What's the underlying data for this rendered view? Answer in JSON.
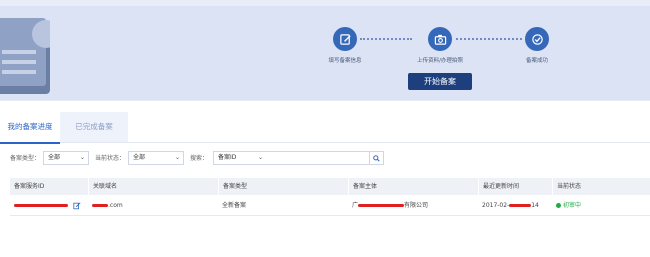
{
  "hero": {
    "steps": [
      {
        "label": "填写备案信息",
        "icon": "edit-icon"
      },
      {
        "label": "上传资料/办理拍照",
        "icon": "camera-icon"
      },
      {
        "label": "备案成功",
        "icon": "check-circle-icon"
      }
    ],
    "start_button": "开始备案"
  },
  "tabs": [
    {
      "label": "我的备案进度",
      "active": true
    },
    {
      "label": "已完成备案",
      "active": false
    }
  ],
  "filters": {
    "type_label": "备案类型：",
    "type_value": "全部",
    "status_label": "当前状态：",
    "status_value": "全部",
    "search_label": "搜索：",
    "search_field_value": "备案ID",
    "search_placeholder": ""
  },
  "table": {
    "columns": [
      "备案服务ID",
      "关联域名",
      "备案类型",
      "备案主体",
      "最近更新时间",
      "当前状态"
    ],
    "rows": [
      {
        "service_id": "",
        "domain_suffix": ".com",
        "type": "全新备案",
        "subject_prefix": "广",
        "subject_suffix": "有限公司",
        "updated_prefix": "2017-02-",
        "updated_suffix": "14",
        "status": "初审中"
      }
    ]
  },
  "colors": {
    "hero_bg": "#dbe3f4",
    "accent": "#3568b8",
    "button": "#1d3f7e",
    "tab_active": "#2b63c8",
    "status_ok": "#22aa44",
    "redaction": "#e02020"
  }
}
